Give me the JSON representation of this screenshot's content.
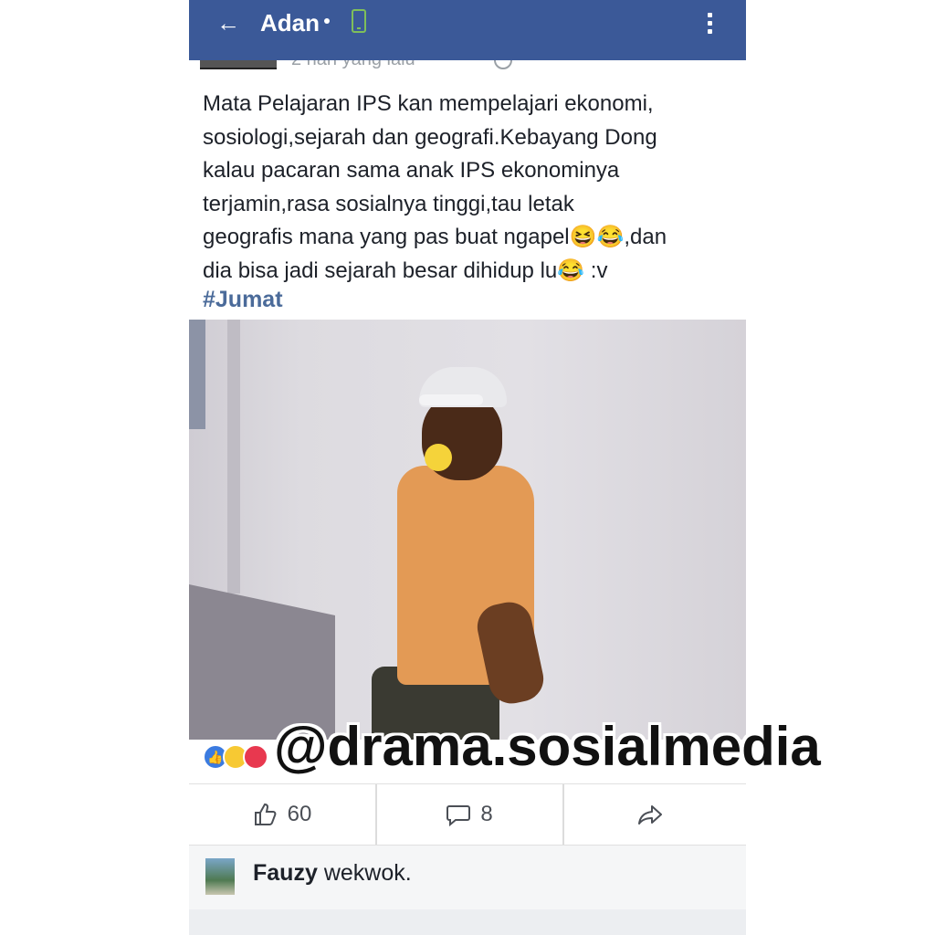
{
  "topbar": {
    "title": "Adan",
    "back_icon": "arrow-left-icon",
    "status_icon": "phone-icon",
    "menu_icon": "kebab-menu-icon",
    "color": "#3b5998"
  },
  "post": {
    "timestamp": "2 hari yang lalu",
    "text": "Mata Pelajaran IPS kan mempelajari ekonomi,\nsosiologi,sejarah dan geografi.Kebayang Dong\nkalau pacaran sama anak IPS ekonominya\nterjamin,rasa sosialnya tinggi,tau letak\ngeografis mana yang pas buat ngapel😆😂,dan\ndia bisa jadi sejarah besar dihidup lu😂 :v",
    "hashtag": "#Jumat"
  },
  "watermark": "@drama.sosialmedia",
  "actions": {
    "like_count": "60",
    "comment_count": "8"
  },
  "comment": {
    "author": "Fauzy",
    "text": "wekwok."
  }
}
